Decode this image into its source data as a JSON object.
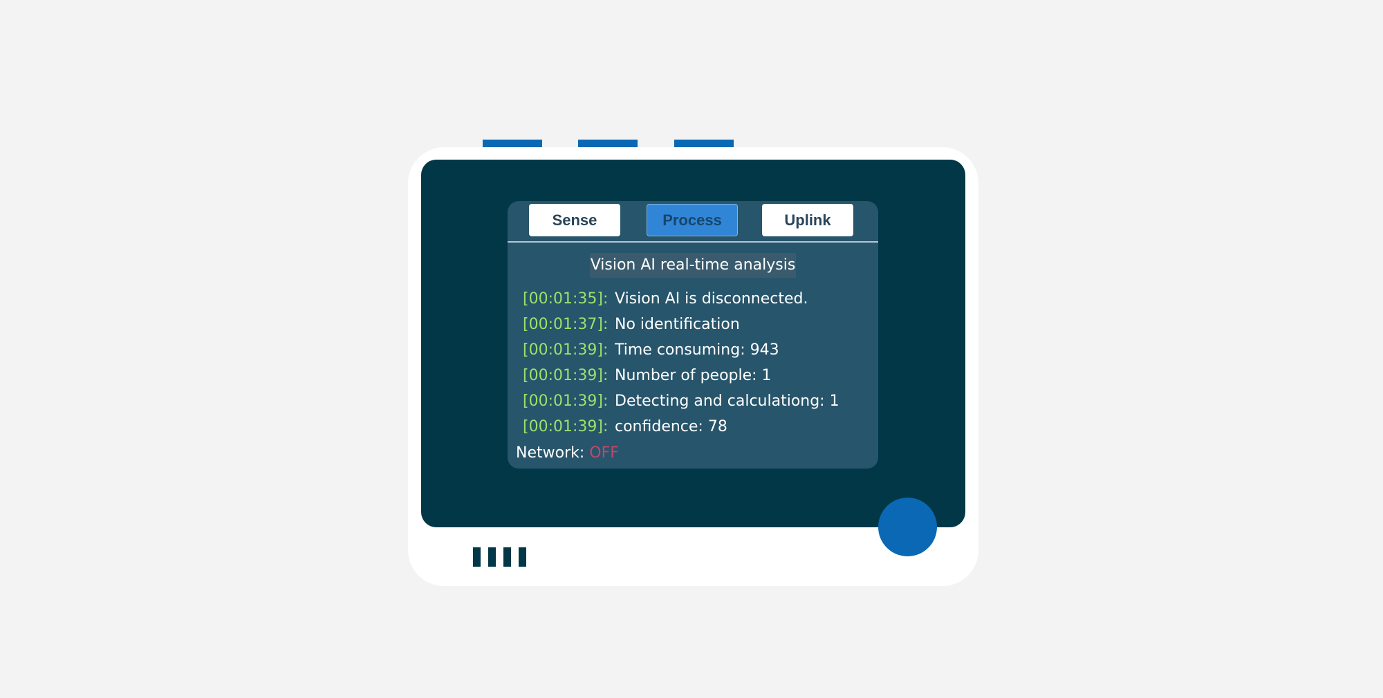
{
  "device": {
    "tabs": [
      {
        "label": "Sense",
        "active": false
      },
      {
        "label": "Process",
        "active": true
      },
      {
        "label": "Uplink",
        "active": false
      }
    ],
    "title": "Vision AI real-time analysis",
    "log": [
      {
        "time": "[00:01:35]:",
        "message": "Vision AI is disconnected."
      },
      {
        "time": "[00:01:37]:",
        "message": "No identification"
      },
      {
        "time": "[00:01:39]:",
        "message": "Time consuming: 943"
      },
      {
        "time": "[00:01:39]:",
        "message": "Number of people: 1"
      },
      {
        "time": "[00:01:39]:",
        "message": "Detecting and calculationg: 1"
      },
      {
        "time": "[00:01:39]:",
        "message": "confidence: 78"
      }
    ],
    "network": {
      "label": "Network:",
      "state": "OFF"
    }
  },
  "colors": {
    "background": "#f3f3f3",
    "device_body": "#ffffff",
    "bezel": "#013747",
    "screen": "#27556b",
    "accent_blue": "#0a68b4",
    "active_tab": "#3185d6",
    "timestamp": "#9be26c",
    "network_off": "#c2476b"
  }
}
